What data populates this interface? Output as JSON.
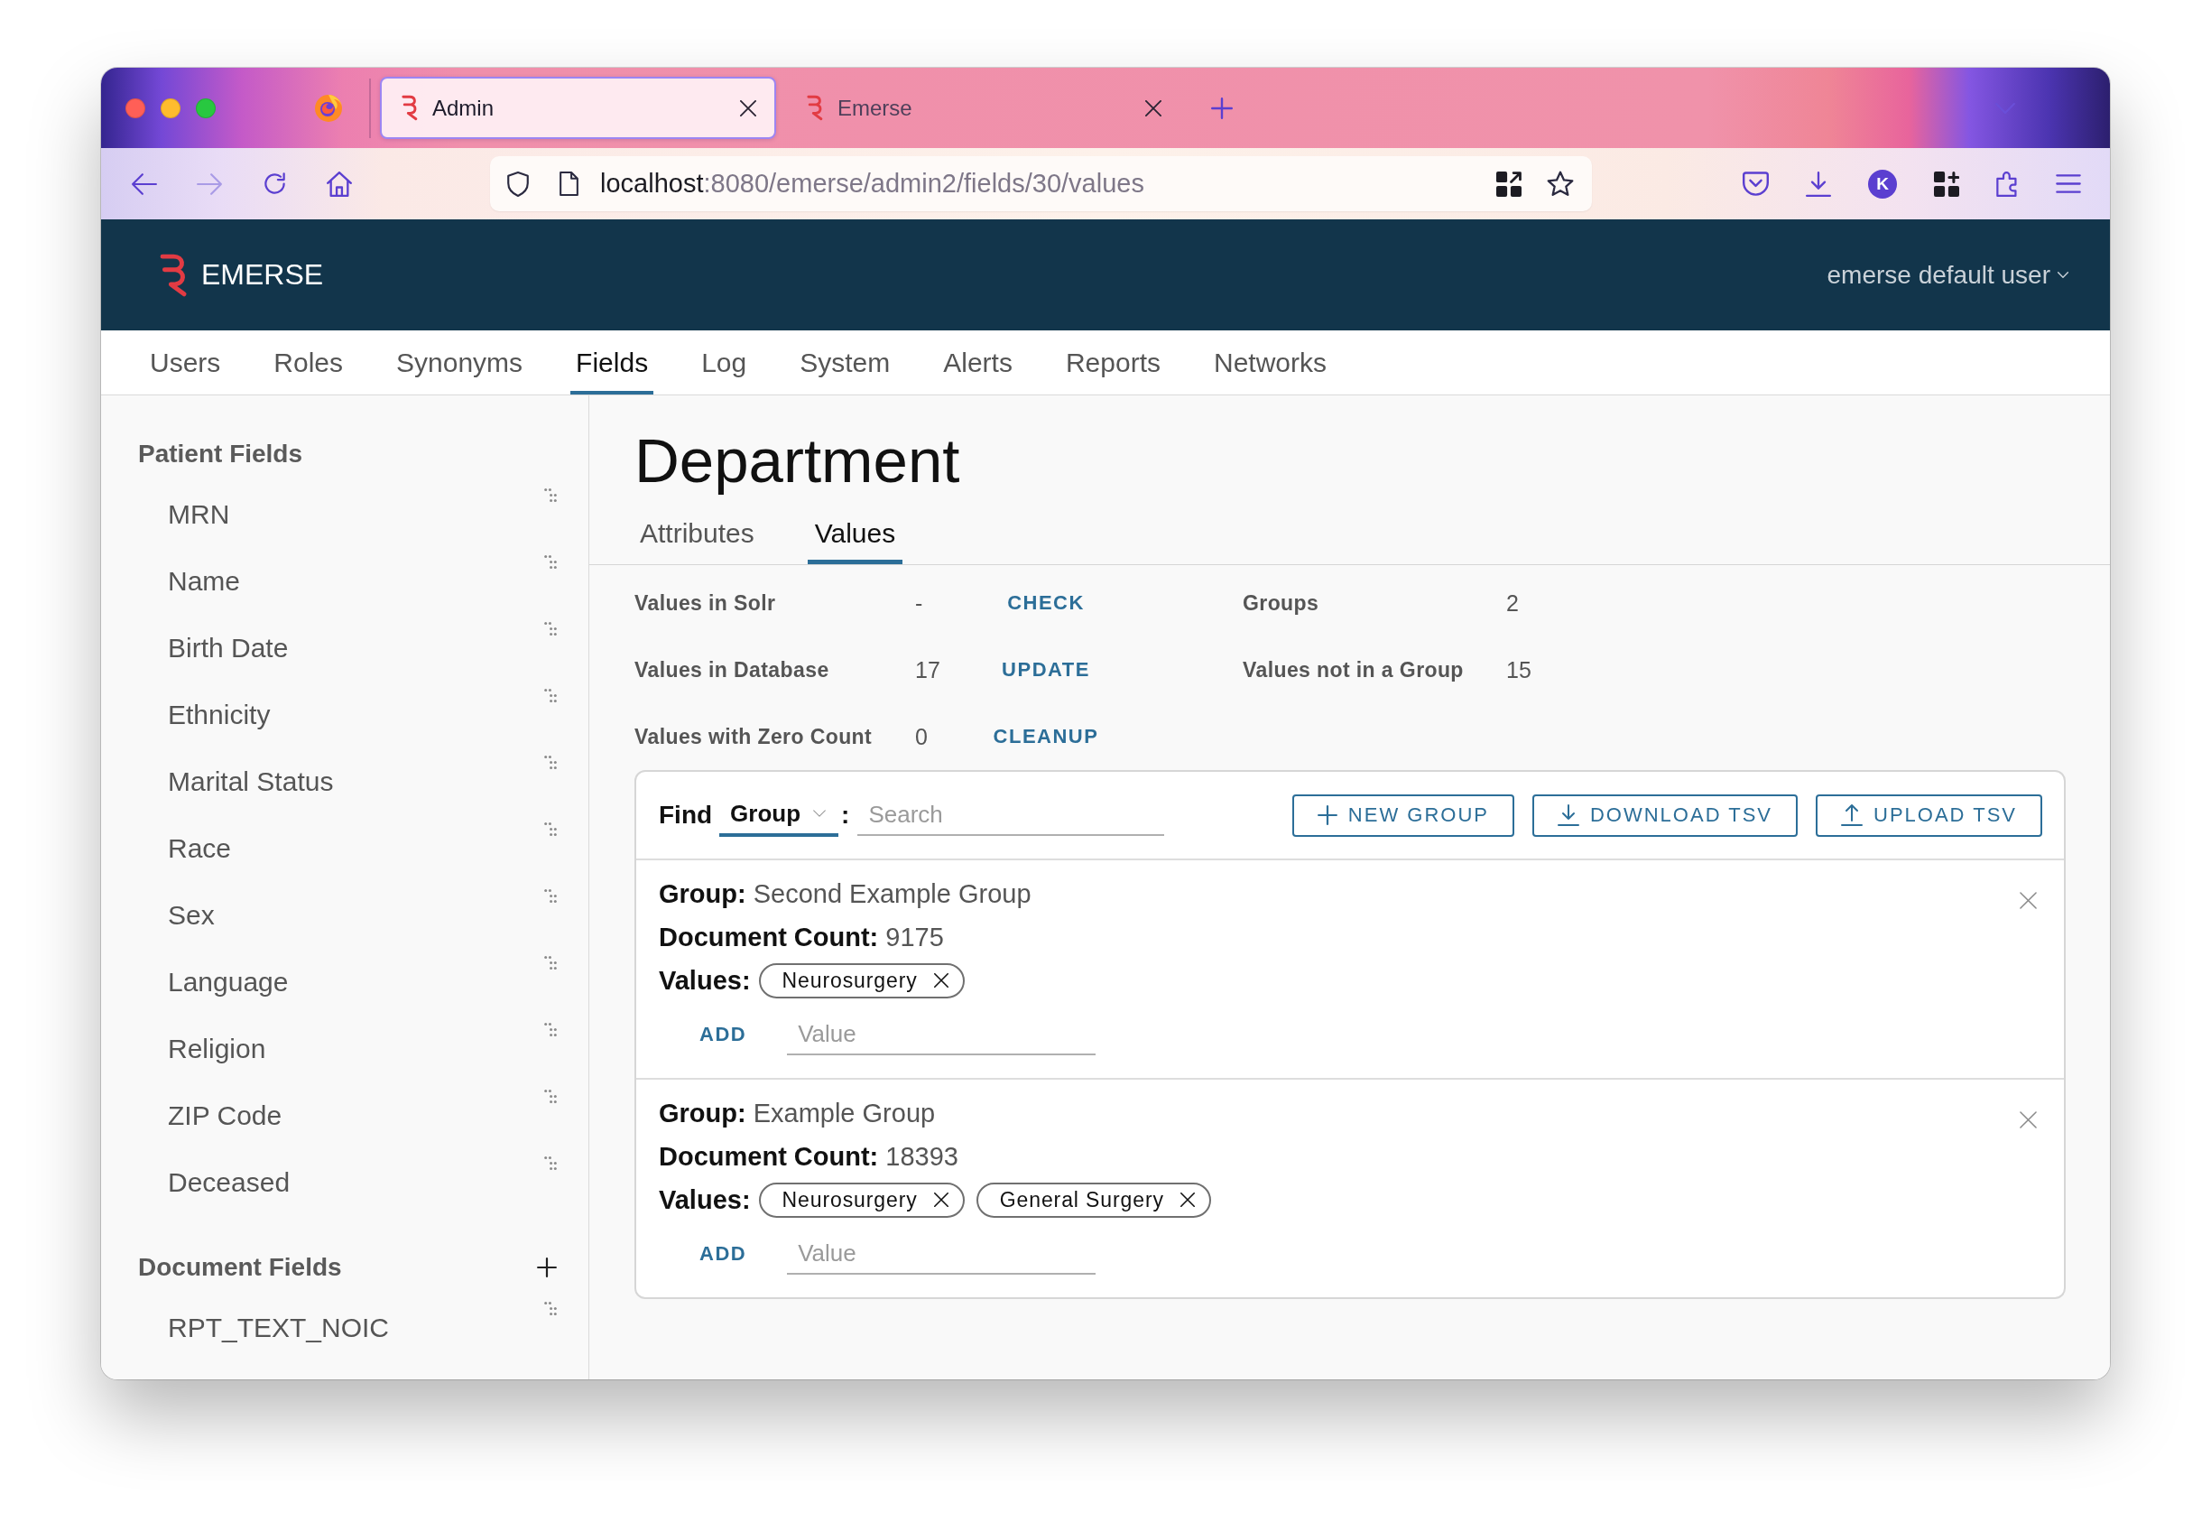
{
  "browser": {
    "tabs": [
      {
        "title": "Admin",
        "selected": true
      },
      {
        "title": "Emerse",
        "selected": false
      }
    ],
    "forward_disabled": true,
    "url": {
      "host": "localhost",
      "path": ":8080/emerse/admin2/fields/30/values"
    },
    "account_initial": "K"
  },
  "header": {
    "logo_text": "EMERSE",
    "user_menu": "emerse default user"
  },
  "nav": [
    {
      "label": "Users",
      "selected": false
    },
    {
      "label": "Roles",
      "selected": false
    },
    {
      "label": "Synonyms",
      "selected": false
    },
    {
      "label": "Fields",
      "selected": true
    },
    {
      "label": "Log",
      "selected": false
    },
    {
      "label": "System",
      "selected": false
    },
    {
      "label": "Alerts",
      "selected": false
    },
    {
      "label": "Reports",
      "selected": false
    },
    {
      "label": "Networks",
      "selected": false
    }
  ],
  "sidebar": {
    "sections": [
      {
        "title": "Patient Fields",
        "addable": false,
        "items": [
          "MRN",
          "Name",
          "Birth Date",
          "Ethnicity",
          "Marital Status",
          "Race",
          "Sex",
          "Language",
          "Religion",
          "ZIP Code",
          "Deceased"
        ]
      },
      {
        "title": "Document Fields",
        "addable": true,
        "items": [
          "RPT_TEXT_NOIC"
        ]
      }
    ]
  },
  "page": {
    "title": "Department",
    "tabs": [
      {
        "label": "Attributes",
        "selected": false
      },
      {
        "label": "Values",
        "selected": true
      }
    ]
  },
  "stats": [
    {
      "label": "Values in Solr",
      "value": "-",
      "action": "CHECK"
    },
    {
      "label": "Values in Database",
      "value": "17",
      "action": "UPDATE"
    },
    {
      "label": "Values with Zero Count",
      "value": "0",
      "action": "CLEANUP"
    }
  ],
  "group_stats": [
    {
      "label": "Groups",
      "value": "2"
    },
    {
      "label": "Values not in a Group",
      "value": "15"
    }
  ],
  "groups_panel": {
    "find_label": "Find",
    "find_by": "Group",
    "separator": ":",
    "search_placeholder": "Search",
    "buttons": [
      {
        "kind": "add",
        "label": "NEW GROUP"
      },
      {
        "kind": "download",
        "label": "DOWNLOAD TSV"
      },
      {
        "kind": "upload",
        "label": "UPLOAD TSV"
      }
    ],
    "groups": [
      {
        "group_label": "Group:",
        "name": "Second Example Group",
        "count_label": "Document Count:",
        "count": "9175",
        "values_label": "Values:",
        "values": [
          "Neurosurgery"
        ],
        "add_label": "ADD",
        "value_placeholder": "Value"
      },
      {
        "group_label": "Group:",
        "name": "Example Group",
        "count_label": "Document Count:",
        "count": "18393",
        "values_label": "Values:",
        "values": [
          "Neurosurgery",
          "General Surgery"
        ],
        "add_label": "ADD",
        "value_placeholder": "Value"
      }
    ]
  }
}
